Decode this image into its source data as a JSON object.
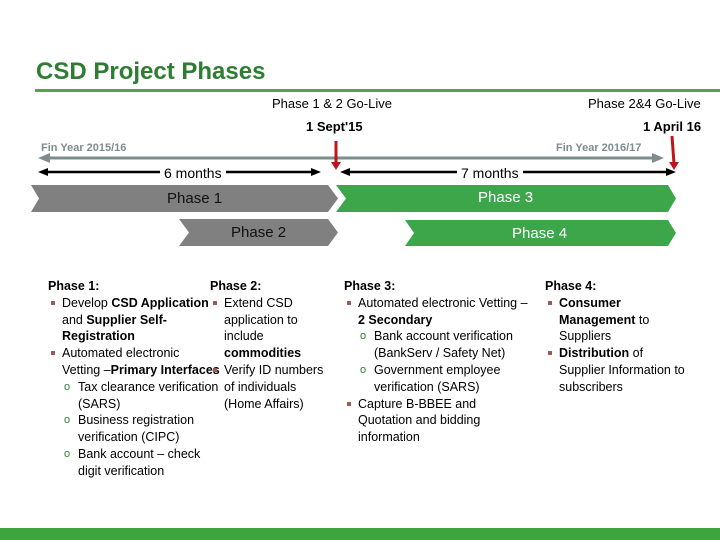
{
  "title": "CSD Project Phases",
  "milestones": {
    "left_golive": "Phase 1 & 2 Go-Live",
    "right_golive": "Phase 2&4 Go-Live",
    "left_date": "1 Sept'15",
    "right_date": "1 April 16"
  },
  "fin_years": {
    "left": "Fin Year  2015/16",
    "right": "Fin Year 2016/17"
  },
  "durations": {
    "left": "6 months",
    "right": "7 months"
  },
  "phases": [
    {
      "label": "Phase 1",
      "color": "#808080"
    },
    {
      "label": "Phase 2",
      "color": "#808080"
    },
    {
      "label": "Phase 3",
      "color": "#3ea64a"
    },
    {
      "label": "Phase 4",
      "color": "#3ea64a"
    }
  ],
  "colors": {
    "title": "#2e7d32",
    "grey_phase": "#808080",
    "green_phase": "#3ea64a",
    "milestone_arrow": "#c0141c",
    "fin_year_arrow": "#7f8c8d",
    "footer": "#3ea53e"
  },
  "details": {
    "phase1": {
      "heading": "Phase 1:",
      "items": [
        {
          "level": 1,
          "parts": [
            {
              "t": "Develop "
            },
            {
              "t": "CSD Application",
              "b": true
            },
            {
              "t": " and "
            },
            {
              "t": "Supplier Self-Registration",
              "b": true
            }
          ]
        },
        {
          "level": 1,
          "parts": [
            {
              "t": "Automated electronic Vetting –"
            },
            {
              "t": "Primary Interfaces",
              "b": true
            }
          ]
        },
        {
          "level": 2,
          "parts": [
            {
              "t": "Tax clearance verification (SARS)"
            }
          ]
        },
        {
          "level": 2,
          "parts": [
            {
              "t": "Business registration verification (CIPC)"
            }
          ]
        },
        {
          "level": 2,
          "parts": [
            {
              "t": "Bank account – check digit verification"
            }
          ]
        }
      ]
    },
    "phase2": {
      "heading": "Phase 2:",
      "items": [
        {
          "level": 1,
          "parts": [
            {
              "t": "Extend CSD application to include "
            },
            {
              "t": "commodities",
              "b": true
            }
          ]
        },
        {
          "level": 1,
          "parts": [
            {
              "t": "Verify ID numbers of individuals (Home Affairs)"
            }
          ]
        }
      ]
    },
    "phase3": {
      "heading": "Phase 3:",
      "items": [
        {
          "level": 1,
          "parts": [
            {
              "t": "Automated electronic Vetting – "
            },
            {
              "t": "2 Secondary",
              "b": true
            }
          ]
        },
        {
          "level": 2,
          "parts": [
            {
              "t": "Bank account verification (BankServ / Safety Net)"
            }
          ]
        },
        {
          "level": 2,
          "parts": [
            {
              "t": "Government employee verification (SARS)"
            }
          ]
        },
        {
          "level": 1,
          "parts": [
            {
              "t": "Capture B-BBEE and Quotation and bidding information"
            }
          ]
        }
      ]
    },
    "phase4": {
      "heading": "Phase 4:",
      "items": [
        {
          "level": 1,
          "parts": [
            {
              "t": "Consumer Management",
              "b": true
            },
            {
              "t": " to Suppliers"
            }
          ]
        },
        {
          "level": 1,
          "parts": [
            {
              "t": "Distribution",
              "b": true
            },
            {
              "t": " of Supplier Information to subscribers"
            }
          ]
        }
      ]
    }
  }
}
